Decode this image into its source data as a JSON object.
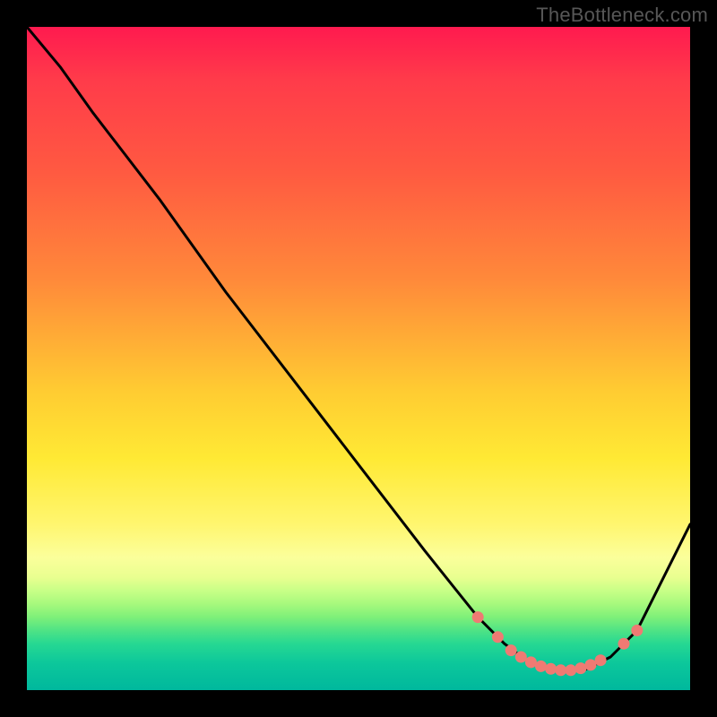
{
  "watermark": "TheBottleneck.com",
  "chart_data": {
    "type": "line",
    "title": "",
    "xlabel": "",
    "ylabel": "",
    "xlim": [
      0,
      100
    ],
    "ylim": [
      0,
      100
    ],
    "grid": false,
    "legend": false,
    "series": [
      {
        "name": "curve",
        "x": [
          0,
          5,
          10,
          20,
          30,
          40,
          50,
          60,
          68,
          72,
          76,
          80,
          84,
          88,
          92,
          100
        ],
        "y": [
          100,
          94,
          87,
          74,
          60,
          47,
          34,
          21,
          11,
          7,
          4,
          3,
          3,
          5,
          9,
          25
        ]
      }
    ],
    "markers": {
      "name": "highlighted-points",
      "color": "#ef7a73",
      "points": [
        {
          "x": 68,
          "y": 11
        },
        {
          "x": 71,
          "y": 8
        },
        {
          "x": 73,
          "y": 6
        },
        {
          "x": 74.5,
          "y": 5
        },
        {
          "x": 76,
          "y": 4.2
        },
        {
          "x": 77.5,
          "y": 3.6
        },
        {
          "x": 79,
          "y": 3.2
        },
        {
          "x": 80.5,
          "y": 3
        },
        {
          "x": 82,
          "y": 3
        },
        {
          "x": 83.5,
          "y": 3.3
        },
        {
          "x": 85,
          "y": 3.8
        },
        {
          "x": 86.5,
          "y": 4.5
        },
        {
          "x": 90,
          "y": 7
        },
        {
          "x": 92,
          "y": 9
        }
      ]
    },
    "colors": {
      "frame": "#000000",
      "curve": "#000000",
      "marker": "#ef7a73",
      "gradient_top": "#ff1a4f",
      "gradient_bottom": "#00b89d"
    }
  }
}
